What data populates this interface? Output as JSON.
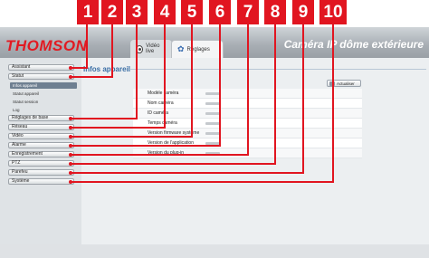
{
  "callouts": [
    "1",
    "2",
    "3",
    "4",
    "5",
    "6",
    "7",
    "8",
    "9",
    "10"
  ],
  "brand": "THOMSON",
  "product_title": "Caméra IP dôme extérieure",
  "tabs": {
    "live": {
      "label": "Vidéo live",
      "icon": "camera-icon"
    },
    "settings": {
      "label": "Réglages",
      "icon": "settings-icon"
    }
  },
  "menu": {
    "assistant": "Assistant",
    "statut": "Statut",
    "statut_sub": [
      "Infos appareil",
      "Statut appareil",
      "Statut session",
      "Log"
    ],
    "items": [
      "Réglages de base",
      "Réseau",
      "Vidéo",
      "Alarme",
      "Enregistrement",
      "PTZ",
      "Parefeu",
      "Système"
    ]
  },
  "panel": {
    "title": "Infos appareil",
    "refresh_label": "Actualiser",
    "rows": [
      "Modèle caméra",
      "Nom caméra",
      "ID caméra",
      "Temps caméra",
      "Version firmware système",
      "Version de l'application",
      "Version du plug-in"
    ]
  },
  "colors": {
    "accent": "#e11520",
    "brand": "#e21a22",
    "link": "#3a6ea5"
  }
}
